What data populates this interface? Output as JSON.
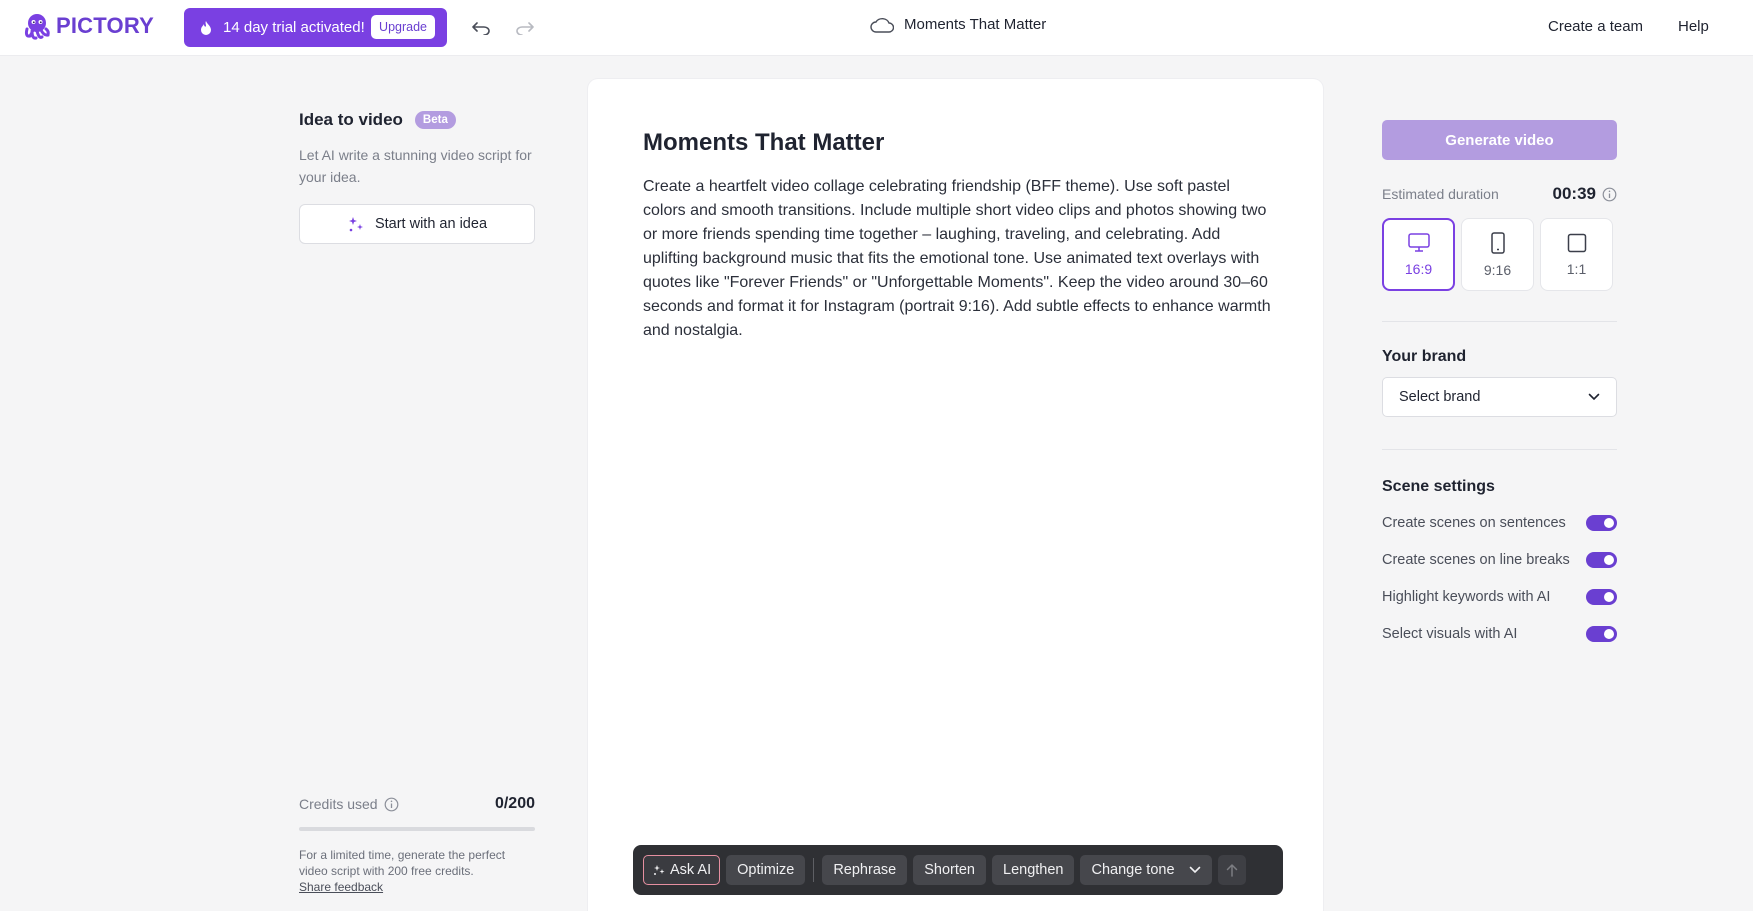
{
  "header": {
    "logo_text": "PICTORY",
    "trial_text": "14 day trial activated!",
    "upgrade_label": "Upgrade",
    "document_title": "Moments That Matter",
    "nav": {
      "create_team": "Create a team",
      "help": "Help"
    }
  },
  "left_panel": {
    "idea_title": "Idea to video",
    "beta_badge": "Beta",
    "idea_description": "Let AI write a stunning video script for your idea.",
    "start_button": "Start with an idea",
    "credits_label": "Credits used",
    "credits_value": "0/200",
    "credits_fraction": 0,
    "credits_note": "For a limited time, generate the perfect video script with 200 free credits.",
    "feedback_link": "Share feedback"
  },
  "editor": {
    "title": "Moments That Matter",
    "body": "Create a heartfelt video collage celebrating friendship (BFF theme). Use soft pastel colors and smooth transitions. Include multiple short video clips and photos showing two or more friends spending time together – laughing, traveling, and celebrating. Add uplifting background music that fits the emotional tone. Use animated text overlays with quotes like \"Forever Friends\" or \"Unforgettable Moments\". Keep the video around 30–60 seconds and format it for Instagram (portrait 9:16). Add subtle effects to enhance warmth and nostalgia."
  },
  "toolbar": {
    "ask_ai": "Ask AI",
    "optimize": "Optimize",
    "rephrase": "Rephrase",
    "shorten": "Shorten",
    "lengthen": "Lengthen",
    "change_tone": "Change tone"
  },
  "right_panel": {
    "generate_button": "Generate video",
    "duration_label": "Estimated duration",
    "duration_value": "00:39",
    "ratios": [
      {
        "label": "16:9",
        "icon": "monitor-icon",
        "active": true
      },
      {
        "label": "9:16",
        "icon": "phone-icon",
        "active": false
      },
      {
        "label": "1:1",
        "icon": "square-icon",
        "active": false
      }
    ],
    "brand_title": "Your brand",
    "brand_select": "Select brand",
    "scene_title": "Scene settings",
    "scene_settings": [
      {
        "label": "Create scenes on sentences",
        "on": true
      },
      {
        "label": "Create scenes on line breaks",
        "on": true
      },
      {
        "label": "Highlight keywords with AI",
        "on": true
      },
      {
        "label": "Select visuals with AI",
        "on": true
      }
    ]
  },
  "colors": {
    "accent": "#7a40e2",
    "logo": "#6a3fd1",
    "generate_disabled": "#b39ce0",
    "toolbar_bg": "#2f3034"
  }
}
